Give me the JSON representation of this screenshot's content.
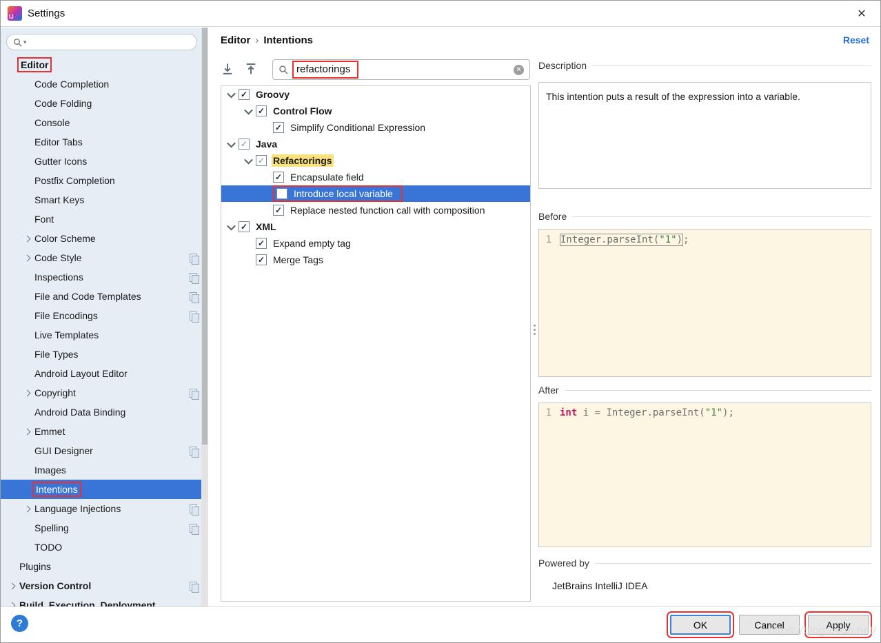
{
  "window": {
    "title": "Settings"
  },
  "icons": {
    "close": "✕",
    "breadcrumb_separator": "›",
    "checkmark": "✓",
    "clear": "✕",
    "help": "?",
    "search_caret": "▾"
  },
  "colors": {
    "selection_blue": "#3875D6",
    "annotation_red": "#ED2F2F",
    "search_match_yellow": "#F9E27D",
    "code_background": "#FCF6E2",
    "reset_link_blue": "#2470D8"
  },
  "sidebar": {
    "search": {
      "placeholder": ""
    },
    "items": [
      {
        "label": "Editor",
        "level": 0,
        "bold": true,
        "annotated": true
      },
      {
        "label": "Code Completion",
        "level": 1
      },
      {
        "label": "Code Folding",
        "level": 1
      },
      {
        "label": "Console",
        "level": 1
      },
      {
        "label": "Editor Tabs",
        "level": 1
      },
      {
        "label": "Gutter Icons",
        "level": 1
      },
      {
        "label": "Postfix Completion",
        "level": 1
      },
      {
        "label": "Smart Keys",
        "level": 1
      },
      {
        "label": "Font",
        "level": 1
      },
      {
        "label": "Color Scheme",
        "level": 1,
        "chevron": true
      },
      {
        "label": "Code Style",
        "level": 1,
        "chevron": true,
        "shared_icon": true
      },
      {
        "label": "Inspections",
        "level": 1,
        "shared_icon": true
      },
      {
        "label": "File and Code Templates",
        "level": 1,
        "shared_icon": true
      },
      {
        "label": "File Encodings",
        "level": 1,
        "shared_icon": true
      },
      {
        "label": "Live Templates",
        "level": 1
      },
      {
        "label": "File Types",
        "level": 1
      },
      {
        "label": "Android Layout Editor",
        "level": 1
      },
      {
        "label": "Copyright",
        "level": 1,
        "chevron": true,
        "shared_icon": true
      },
      {
        "label": "Android Data Binding",
        "level": 1
      },
      {
        "label": "Emmet",
        "level": 1,
        "chevron": true
      },
      {
        "label": "GUI Designer",
        "level": 1,
        "shared_icon": true
      },
      {
        "label": "Images",
        "level": 1
      },
      {
        "label": "Intentions",
        "level": 1,
        "selected": true,
        "annotated": true
      },
      {
        "label": "Language Injections",
        "level": 1,
        "chevron": true,
        "shared_icon": true
      },
      {
        "label": "Spelling",
        "level": 1,
        "shared_icon": true
      },
      {
        "label": "TODO",
        "level": 1
      },
      {
        "label": "Plugins",
        "level": 0
      },
      {
        "label": "Version Control",
        "level": 0,
        "chevron": true,
        "bold": true,
        "shared_icon": true
      },
      {
        "label": "Build, Execution, Deployment",
        "level": 0,
        "chevron": true,
        "bold": true
      }
    ]
  },
  "header": {
    "breadcrumb": {
      "section": "Editor",
      "page": "Intentions"
    },
    "reset_label": "Reset"
  },
  "toolbar": {
    "search_value": "refactorings"
  },
  "tree": {
    "items": [
      {
        "label": "Groovy",
        "level": 0,
        "expandable": true,
        "checked": "checked",
        "bold": true
      },
      {
        "label": "Control Flow",
        "level": 1,
        "expandable": true,
        "checked": "checked",
        "bold": true
      },
      {
        "label": "Simplify Conditional Expression",
        "level": 2,
        "checked": "checked"
      },
      {
        "label": "Java",
        "level": 0,
        "expandable": true,
        "checked": "partial",
        "bold": true
      },
      {
        "label": "Refactorings",
        "level": 1,
        "expandable": true,
        "checked": "partial",
        "bold": true,
        "highlight": true
      },
      {
        "label": "Encapsulate field",
        "level": 2,
        "checked": "checked"
      },
      {
        "label": "Introduce local variable",
        "level": 2,
        "checked": "unchecked",
        "selected": true,
        "annotated": true
      },
      {
        "label": "Replace nested function call with composition",
        "level": 2,
        "checked": "checked"
      },
      {
        "label": "XML",
        "level": 0,
        "expandable": true,
        "checked": "checked",
        "bold": true
      },
      {
        "label": "Expand empty tag",
        "level": 1,
        "checked": "checked"
      },
      {
        "label": "Merge Tags",
        "level": 1,
        "checked": "checked"
      }
    ]
  },
  "detail": {
    "description_label": "Description",
    "description_text": "This intention puts a result of the expression into a variable.",
    "before_label": "Before",
    "before_code": {
      "num": "1",
      "expr_pre": "Integer.parseInt(",
      "string": "\"1\"",
      "expr_post": ")",
      "semicolon": ";"
    },
    "after_label": "After",
    "after_code": {
      "num": "1",
      "keyword": "int",
      "mid": " i = Integer.parseInt(",
      "string": "\"1\"",
      "end": ");"
    },
    "powered_by_label": "Powered by",
    "powered_by_value": "JetBrains IntelliJ IDEA"
  },
  "footer": {
    "ok_label": "OK",
    "cancel_label": "Cancel",
    "apply_label": "Apply"
  },
  "watermark": "https://blog.csdn.net/"
}
